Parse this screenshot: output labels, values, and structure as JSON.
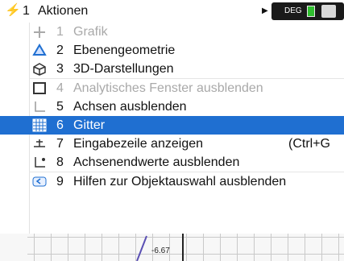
{
  "header": {
    "number": "1",
    "label": "Aktionen",
    "status_text": "DEG",
    "colors": {
      "battery": "#2fbf2f"
    }
  },
  "menu": {
    "items": [
      {
        "number": "1",
        "label": "Grafik",
        "disabled": true,
        "icon": "graph-icon"
      },
      {
        "number": "2",
        "label": "Ebenengeometrie",
        "disabled": false,
        "icon": "plane-geometry-icon"
      },
      {
        "number": "3",
        "label": "3D-Darstellungen",
        "disabled": false,
        "icon": "3d-icon"
      },
      {
        "number": "4",
        "label": "Analytisches Fenster ausblenden",
        "disabled": true,
        "icon": "analytic-window-icon"
      },
      {
        "number": "5",
        "label": "Achsen ausblenden",
        "disabled": false,
        "icon": "axes-icon"
      },
      {
        "number": "6",
        "label": "Gitter",
        "selected": true,
        "icon": "grid-icon"
      },
      {
        "number": "7",
        "label": "Eingabezeile anzeigen",
        "shortcut": "(Ctrl+G",
        "icon": "entry-line-icon"
      },
      {
        "number": "8",
        "label": "Achsenendwerte ausblenden",
        "disabled": false,
        "icon": "axis-endvalues-icon"
      },
      {
        "number": "9",
        "label": "Hilfen zur Objektauswahl ausblenden",
        "disabled": false,
        "icon": "object-selection-icon"
      }
    ],
    "colors": {
      "selected_bg": "#1f6fd1",
      "disabled_text": "#a9a9a9"
    }
  },
  "graph": {
    "axis_label": "-6.67"
  }
}
